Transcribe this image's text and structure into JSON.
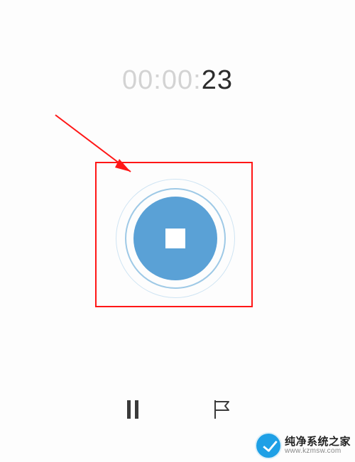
{
  "timer": {
    "faded_part": "00:00:",
    "active_part": "23"
  },
  "annotation": {
    "box_color": "#ff1616",
    "arrow_color": "#ff1616"
  },
  "stop_button": {
    "disc_color": "#5aa1d6",
    "ring_color_outer": "#cfe4f3",
    "ring_color_inner": "#9ec9e6",
    "square_color": "#ffffff"
  },
  "controls": {
    "pause_icon": "pause-icon",
    "flag_icon": "flag-icon"
  },
  "watermark": {
    "title": "纯净系统之家",
    "url": "www.kzmsw.com",
    "accent": "#1ea0e6"
  }
}
